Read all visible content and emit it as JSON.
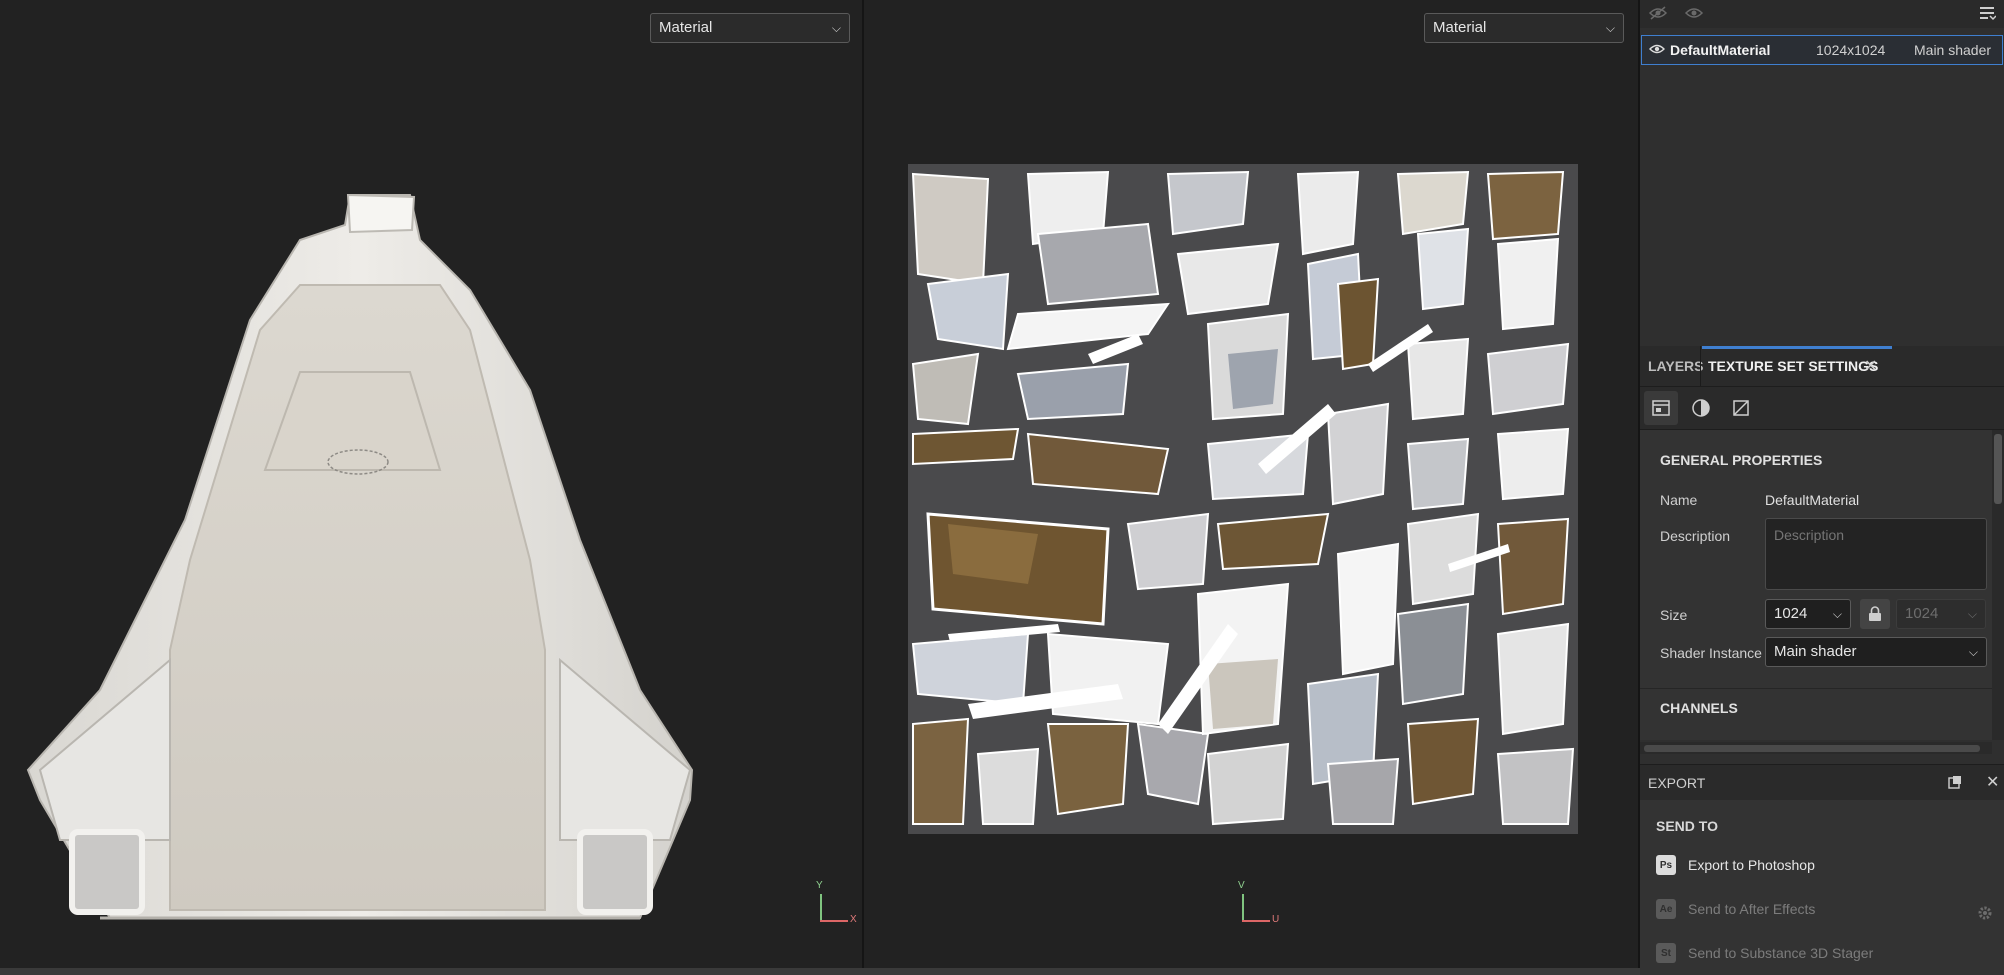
{
  "viewport_3d": {
    "mode_select": "Material",
    "axis_labels": {
      "y": "Y",
      "x": "X"
    }
  },
  "viewport_2d": {
    "mode_select": "Material",
    "axis_labels": {
      "v": "V",
      "u": "U"
    }
  },
  "texture_set_list": {
    "items": [
      {
        "name": "DefaultMaterial",
        "resolution": "1024x1024",
        "shader": "Main shader",
        "visible": true,
        "selected": true
      }
    ]
  },
  "tabs": {
    "layers": "LAYERS",
    "texture_set_settings": "TEXTURE SET SETTINGS",
    "active": "texture_set_settings"
  },
  "general_properties": {
    "title": "GENERAL PROPERTIES",
    "name_label": "Name",
    "name_value": "DefaultMaterial",
    "description_label": "Description",
    "description_placeholder": "Description",
    "size_label": "Size",
    "size_value": "1024",
    "size_value_linked": "1024",
    "shader_instance_label": "Shader Instance",
    "shader_instance_value": "Main shader"
  },
  "channels": {
    "title": "CHANNELS"
  },
  "export": {
    "title": "EXPORT",
    "send_to_label": "SEND TO",
    "items": [
      {
        "icon": "Ps",
        "label": "Export to Photoshop",
        "enabled": true
      },
      {
        "icon": "Ae",
        "label": "Send to After Effects",
        "enabled": false
      },
      {
        "icon": "St",
        "label": "Send to Substance 3D Stager",
        "enabled": false
      }
    ]
  },
  "colors": {
    "accent": "#3f7fd0",
    "panel_bg": "#2f2f2f",
    "viewport_bg": "#222222"
  }
}
